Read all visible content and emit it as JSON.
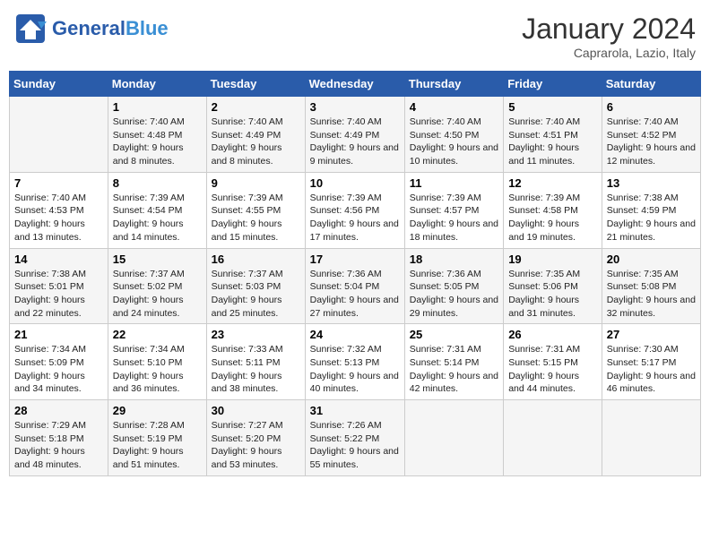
{
  "header": {
    "logo_general": "General",
    "logo_blue": "Blue",
    "title": "January 2024",
    "subtitle": "Caprarola, Lazio, Italy"
  },
  "columns": [
    "Sunday",
    "Monday",
    "Tuesday",
    "Wednesday",
    "Thursday",
    "Friday",
    "Saturday"
  ],
  "weeks": [
    [
      {
        "day": "",
        "sunrise": "",
        "sunset": "",
        "daylight": ""
      },
      {
        "day": "1",
        "sunrise": "Sunrise: 7:40 AM",
        "sunset": "Sunset: 4:48 PM",
        "daylight": "Daylight: 9 hours and 8 minutes."
      },
      {
        "day": "2",
        "sunrise": "Sunrise: 7:40 AM",
        "sunset": "Sunset: 4:49 PM",
        "daylight": "Daylight: 9 hours and 8 minutes."
      },
      {
        "day": "3",
        "sunrise": "Sunrise: 7:40 AM",
        "sunset": "Sunset: 4:49 PM",
        "daylight": "Daylight: 9 hours and 9 minutes."
      },
      {
        "day": "4",
        "sunrise": "Sunrise: 7:40 AM",
        "sunset": "Sunset: 4:50 PM",
        "daylight": "Daylight: 9 hours and 10 minutes."
      },
      {
        "day": "5",
        "sunrise": "Sunrise: 7:40 AM",
        "sunset": "Sunset: 4:51 PM",
        "daylight": "Daylight: 9 hours and 11 minutes."
      },
      {
        "day": "6",
        "sunrise": "Sunrise: 7:40 AM",
        "sunset": "Sunset: 4:52 PM",
        "daylight": "Daylight: 9 hours and 12 minutes."
      }
    ],
    [
      {
        "day": "7",
        "sunrise": "Sunrise: 7:40 AM",
        "sunset": "Sunset: 4:53 PM",
        "daylight": "Daylight: 9 hours and 13 minutes."
      },
      {
        "day": "8",
        "sunrise": "Sunrise: 7:39 AM",
        "sunset": "Sunset: 4:54 PM",
        "daylight": "Daylight: 9 hours and 14 minutes."
      },
      {
        "day": "9",
        "sunrise": "Sunrise: 7:39 AM",
        "sunset": "Sunset: 4:55 PM",
        "daylight": "Daylight: 9 hours and 15 minutes."
      },
      {
        "day": "10",
        "sunrise": "Sunrise: 7:39 AM",
        "sunset": "Sunset: 4:56 PM",
        "daylight": "Daylight: 9 hours and 17 minutes."
      },
      {
        "day": "11",
        "sunrise": "Sunrise: 7:39 AM",
        "sunset": "Sunset: 4:57 PM",
        "daylight": "Daylight: 9 hours and 18 minutes."
      },
      {
        "day": "12",
        "sunrise": "Sunrise: 7:39 AM",
        "sunset": "Sunset: 4:58 PM",
        "daylight": "Daylight: 9 hours and 19 minutes."
      },
      {
        "day": "13",
        "sunrise": "Sunrise: 7:38 AM",
        "sunset": "Sunset: 4:59 PM",
        "daylight": "Daylight: 9 hours and 21 minutes."
      }
    ],
    [
      {
        "day": "14",
        "sunrise": "Sunrise: 7:38 AM",
        "sunset": "Sunset: 5:01 PM",
        "daylight": "Daylight: 9 hours and 22 minutes."
      },
      {
        "day": "15",
        "sunrise": "Sunrise: 7:37 AM",
        "sunset": "Sunset: 5:02 PM",
        "daylight": "Daylight: 9 hours and 24 minutes."
      },
      {
        "day": "16",
        "sunrise": "Sunrise: 7:37 AM",
        "sunset": "Sunset: 5:03 PM",
        "daylight": "Daylight: 9 hours and 25 minutes."
      },
      {
        "day": "17",
        "sunrise": "Sunrise: 7:36 AM",
        "sunset": "Sunset: 5:04 PM",
        "daylight": "Daylight: 9 hours and 27 minutes."
      },
      {
        "day": "18",
        "sunrise": "Sunrise: 7:36 AM",
        "sunset": "Sunset: 5:05 PM",
        "daylight": "Daylight: 9 hours and 29 minutes."
      },
      {
        "day": "19",
        "sunrise": "Sunrise: 7:35 AM",
        "sunset": "Sunset: 5:06 PM",
        "daylight": "Daylight: 9 hours and 31 minutes."
      },
      {
        "day": "20",
        "sunrise": "Sunrise: 7:35 AM",
        "sunset": "Sunset: 5:08 PM",
        "daylight": "Daylight: 9 hours and 32 minutes."
      }
    ],
    [
      {
        "day": "21",
        "sunrise": "Sunrise: 7:34 AM",
        "sunset": "Sunset: 5:09 PM",
        "daylight": "Daylight: 9 hours and 34 minutes."
      },
      {
        "day": "22",
        "sunrise": "Sunrise: 7:34 AM",
        "sunset": "Sunset: 5:10 PM",
        "daylight": "Daylight: 9 hours and 36 minutes."
      },
      {
        "day": "23",
        "sunrise": "Sunrise: 7:33 AM",
        "sunset": "Sunset: 5:11 PM",
        "daylight": "Daylight: 9 hours and 38 minutes."
      },
      {
        "day": "24",
        "sunrise": "Sunrise: 7:32 AM",
        "sunset": "Sunset: 5:13 PM",
        "daylight": "Daylight: 9 hours and 40 minutes."
      },
      {
        "day": "25",
        "sunrise": "Sunrise: 7:31 AM",
        "sunset": "Sunset: 5:14 PM",
        "daylight": "Daylight: 9 hours and 42 minutes."
      },
      {
        "day": "26",
        "sunrise": "Sunrise: 7:31 AM",
        "sunset": "Sunset: 5:15 PM",
        "daylight": "Daylight: 9 hours and 44 minutes."
      },
      {
        "day": "27",
        "sunrise": "Sunrise: 7:30 AM",
        "sunset": "Sunset: 5:17 PM",
        "daylight": "Daylight: 9 hours and 46 minutes."
      }
    ],
    [
      {
        "day": "28",
        "sunrise": "Sunrise: 7:29 AM",
        "sunset": "Sunset: 5:18 PM",
        "daylight": "Daylight: 9 hours and 48 minutes."
      },
      {
        "day": "29",
        "sunrise": "Sunrise: 7:28 AM",
        "sunset": "Sunset: 5:19 PM",
        "daylight": "Daylight: 9 hours and 51 minutes."
      },
      {
        "day": "30",
        "sunrise": "Sunrise: 7:27 AM",
        "sunset": "Sunset: 5:20 PM",
        "daylight": "Daylight: 9 hours and 53 minutes."
      },
      {
        "day": "31",
        "sunrise": "Sunrise: 7:26 AM",
        "sunset": "Sunset: 5:22 PM",
        "daylight": "Daylight: 9 hours and 55 minutes."
      },
      {
        "day": "",
        "sunrise": "",
        "sunset": "",
        "daylight": ""
      },
      {
        "day": "",
        "sunrise": "",
        "sunset": "",
        "daylight": ""
      },
      {
        "day": "",
        "sunrise": "",
        "sunset": "",
        "daylight": ""
      }
    ]
  ]
}
